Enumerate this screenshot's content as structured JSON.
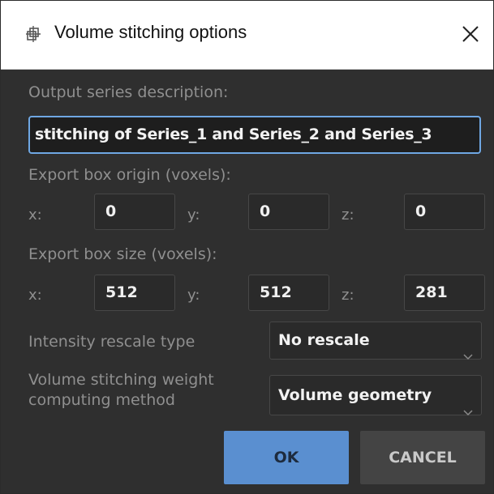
{
  "window": {
    "title": "Volume stitching options",
    "app_icon": "stitch-icon",
    "close_icon": "close-icon"
  },
  "output": {
    "label": "Output series description:",
    "value": "stitching of Series_1 and Series_2 and Series_3"
  },
  "origin": {
    "label": "Export box origin (voxels):",
    "x_label": "x:",
    "x_value": "0",
    "y_label": "y:",
    "y_value": "0",
    "z_label": "z:",
    "z_value": "0"
  },
  "size": {
    "label": "Export box size (voxels):",
    "x_label": "x:",
    "x_value": "512",
    "y_label": "y:",
    "y_value": "512",
    "z_label": "z:",
    "z_value": "281"
  },
  "rescale": {
    "label": "Intensity rescale type",
    "selected": "No rescale"
  },
  "weight": {
    "label_line1": "Volume stitching weight",
    "label_line2": "computing method",
    "selected": "Volume geometry"
  },
  "buttons": {
    "ok": "OK",
    "cancel": "CANCEL"
  },
  "colors": {
    "accent": "#5a8fd0",
    "focus_border": "#6fa7e3",
    "background": "#2f2f2f"
  }
}
